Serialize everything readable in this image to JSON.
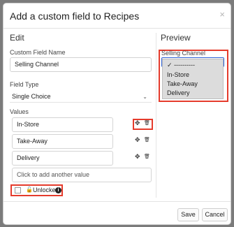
{
  "modal": {
    "title": "Add a custom field to Recipes",
    "close": "×"
  },
  "edit": {
    "heading": "Edit",
    "field_name_label": "Custom Field Name",
    "field_name_value": "Selling Channel",
    "field_type_label": "Field Type",
    "field_type_value": "Single Choice",
    "values_label": "Values",
    "values": [
      "In-Store",
      "Take-Away",
      "Delivery"
    ],
    "add_placeholder": "Click to add another value",
    "unlocked_label": "Unlocked",
    "info_glyph": "i"
  },
  "preview": {
    "heading": "Preview",
    "label": "Selling Channel",
    "options": [
      "----------",
      "In-Store",
      "Take-Away",
      "Delivery"
    ],
    "selected_mark": "✓"
  },
  "footer": {
    "save_label": "Save",
    "cancel_label": "Cancel"
  },
  "icons": {
    "move": "✥",
    "trash": "🗑",
    "lock": "🔓",
    "chevron": "⌄"
  },
  "colors": {
    "highlight": "#e53b2c",
    "focus_border": "#2f62d6"
  }
}
